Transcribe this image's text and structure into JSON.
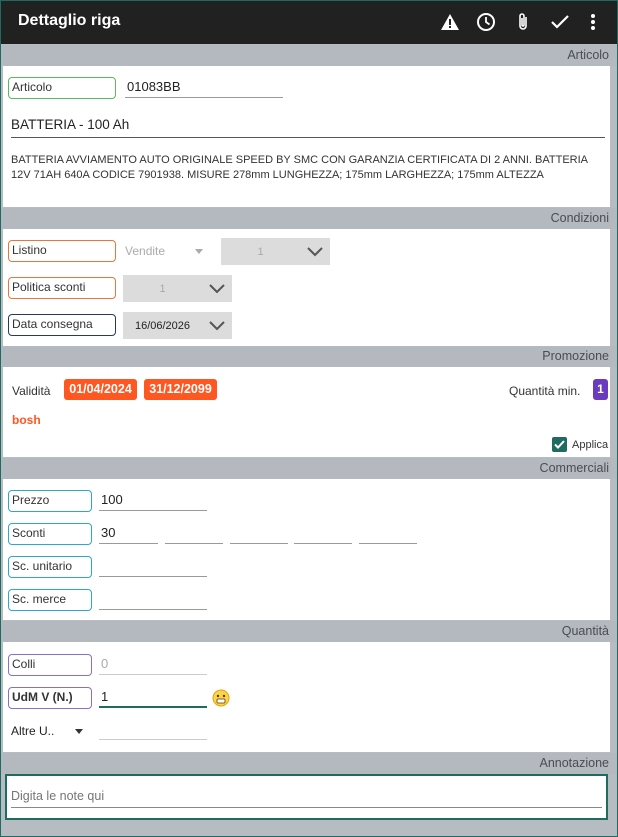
{
  "appbar": {
    "title": "Dettaglio riga",
    "icons": [
      "warning-icon",
      "clock-icon",
      "attach-icon",
      "check-icon",
      "more-vert-icon"
    ]
  },
  "sections": {
    "articolo": "Articolo",
    "condizioni": "Condizioni",
    "promozione": "Promozione",
    "commerciali": "Commerciali",
    "quantita": "Quantità",
    "annotazione": "Annotazione"
  },
  "articolo": {
    "label": "Articolo",
    "code": "01083BB",
    "name": "BATTERIA - 100 Ah",
    "description": "BATTERIA AVVIAMENTO AUTO ORIGINALE SPEED BY SMC CON GARANZIA CERTIFICATA DI 2 ANNI. BATTERIA 12V 71AH 640A CODICE 7901938. MISURE 278mm LUNGHEZZA; 175mm LARGHEZZA; 175mm ALTEZZA"
  },
  "condizioni": {
    "listino_label": "Listino",
    "listino_type": "Vendite",
    "listino_value": "1",
    "politica_label": "Politica sconti",
    "politica_value": "1",
    "data_label": "Data consegna",
    "data_value": "16/06/2026"
  },
  "promozione": {
    "validita_label": "Validità",
    "date_from": "01/04/2024",
    "date_to": "31/12/2099",
    "qty_label": "Quantità min.",
    "qty_value": "1",
    "brand": "bosh",
    "applica_label": "Applica",
    "applica_checked": true
  },
  "commerciali": {
    "prezzo_label": "Prezzo",
    "prezzo_value": "100",
    "sconti_label": "Sconti",
    "sconti_values": [
      "30",
      "",
      "",
      "",
      ""
    ],
    "sc_unitario_label": "Sc. unitario",
    "sc_unitario_value": "",
    "sc_merce_label": "Sc. merce",
    "sc_merce_value": ""
  },
  "quantita": {
    "colli_label": "Colli",
    "colli_value": "0",
    "udm_label": "UdM V (N.)",
    "udm_value": "1",
    "altre_label": "Altre U..",
    "altre_value": ""
  },
  "annotazione": {
    "placeholder": "Digita le note qui"
  },
  "colors": {
    "appbar": "#212121",
    "promo_badge": "#ff5722",
    "qty_badge": "#6a3bbf",
    "focus": "#1f6b62",
    "brand_text": "#ff5722"
  }
}
